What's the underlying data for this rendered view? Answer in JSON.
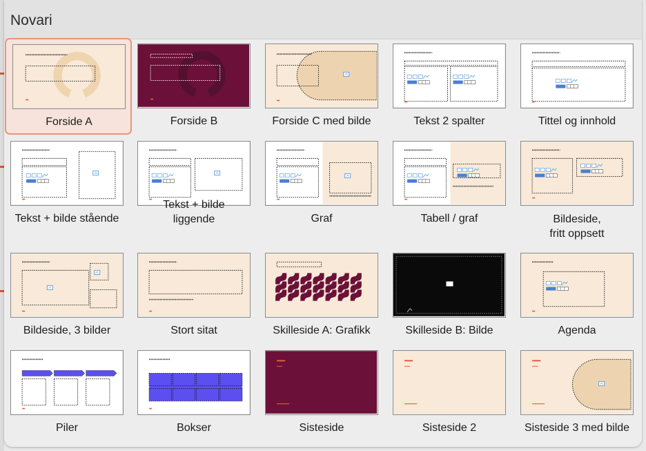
{
  "window": {
    "title": "Novari"
  },
  "layouts": [
    {
      "label": "Forside A",
      "selected": true
    },
    {
      "label": "Forside B"
    },
    {
      "label": "Forside C med bilde"
    },
    {
      "label": "Tekst 2 spalter"
    },
    {
      "label": "Tittel og innhold"
    },
    {
      "label": "Tekst + bilde stående"
    },
    {
      "label": "Tekst + bilde\nliggende"
    },
    {
      "label": "Graf"
    },
    {
      "label": "Tabell / graf"
    },
    {
      "label": "Bildeside,\nfritt oppsett"
    },
    {
      "label": "Bildeside, 3 bilder"
    },
    {
      "label": "Stort sitat"
    },
    {
      "label": "Skilleside A: Grafikk"
    },
    {
      "label": "Skilleside B: Bilde"
    },
    {
      "label": "Agenda"
    },
    {
      "label": "Piler"
    },
    {
      "label": "Bokser"
    },
    {
      "label": "Sisteside"
    },
    {
      "label": "Sisteside 2"
    },
    {
      "label": "Sisteside 3 med bilde"
    }
  ],
  "colors": {
    "cream": "#f8e9d8",
    "burgundy": "#6b1038",
    "accent": "#e35d3a",
    "placeholder_blue": "#4a90d9",
    "bar_blue": "#5b4ff0"
  }
}
